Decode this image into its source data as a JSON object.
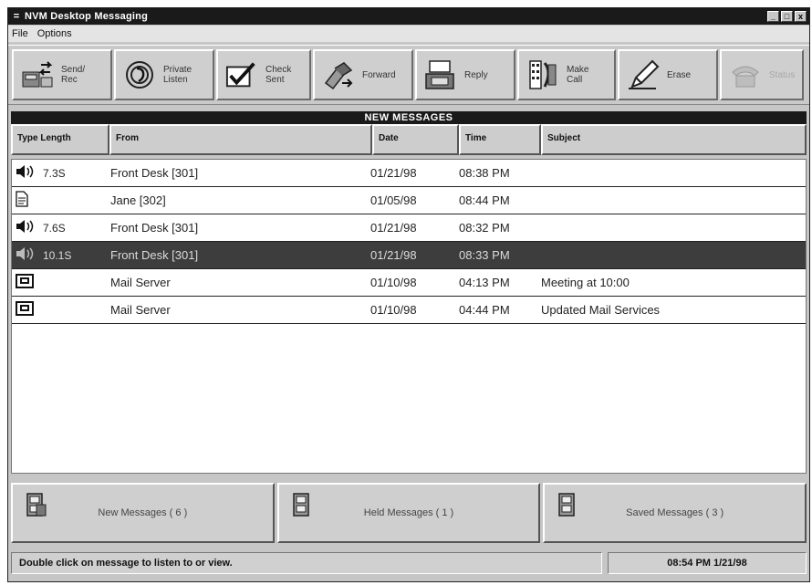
{
  "window": {
    "title": "NVM Desktop Messaging",
    "sysmenu": "=",
    "controls": [
      "_",
      "□",
      "x"
    ]
  },
  "menu": {
    "items": [
      {
        "label": "File"
      },
      {
        "label": "Options"
      }
    ]
  },
  "toolbar": {
    "buttons": [
      {
        "label": "Send/\nRec",
        "icon": "send-receive-icon"
      },
      {
        "label": "Private\nListen",
        "icon": "ear-icon"
      },
      {
        "label": "Check\nSent",
        "icon": "checkmark-icon"
      },
      {
        "label": "Forward",
        "icon": "forward-icon"
      },
      {
        "label": "Reply",
        "icon": "reply-icon"
      },
      {
        "label": "Make\nCall",
        "icon": "phone-keypad-icon"
      },
      {
        "label": "Erase",
        "icon": "pencil-eraser-icon"
      },
      {
        "label": "Status",
        "icon": "telephone-icon"
      }
    ]
  },
  "list": {
    "banner": "NEW MESSAGES",
    "columns": {
      "type_length": "Type  Length",
      "from": "From",
      "date": "Date",
      "time": "Time",
      "subject": "Subject"
    },
    "rows": [
      {
        "type": "voice",
        "length": "7.3S",
        "from": "Front Desk [301]",
        "date": "01/21/98",
        "time": "08:38 PM",
        "subject": ""
      },
      {
        "type": "document",
        "length": "",
        "from": "Jane [302]",
        "date": "01/05/98",
        "time": "08:44 PM",
        "subject": ""
      },
      {
        "type": "voice",
        "length": "7.6S",
        "from": "Front Desk [301]",
        "date": "01/21/98",
        "time": "08:32 PM",
        "subject": ""
      },
      {
        "type": "voice",
        "length": "10.1S",
        "from": "Front Desk [301]",
        "date": "01/21/98",
        "time": "08:33 PM",
        "subject": "",
        "selected": true
      },
      {
        "type": "email",
        "length": "",
        "from": "Mail Server",
        "date": "01/10/98",
        "time": "04:13 PM",
        "subject": "Meeting at 10:00"
      },
      {
        "type": "email",
        "length": "",
        "from": "Mail Server",
        "date": "01/10/98",
        "time": "04:44 PM",
        "subject": "Updated Mail Services"
      }
    ]
  },
  "folders": [
    {
      "label": "New Messages ( 6 )"
    },
    {
      "label": "Held Messages ( 1 )"
    },
    {
      "label": "Saved Messages ( 3 )"
    }
  ],
  "status": {
    "message": "Double click on message to listen to or view.",
    "clock": "08:54 PM 1/21/98"
  },
  "colors": {
    "title_bar": "#1a1a1a",
    "selected_row": "#3d3d3d",
    "window_face": "#c6c6c6"
  }
}
